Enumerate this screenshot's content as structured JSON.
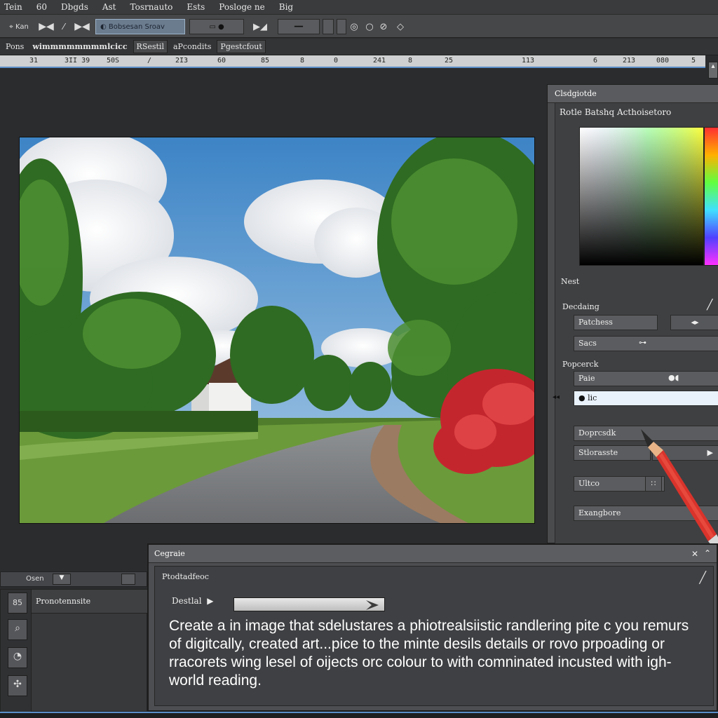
{
  "menu": [
    "Tein",
    "60",
    "Dbgds",
    "Ast",
    "Tosrnauto",
    "Ests",
    "Posloge ne",
    "Big"
  ],
  "toolbar": {
    "mode_label": "Kan",
    "preset_label": "Bobsesan Sroav"
  },
  "options": {
    "label1": "Pons",
    "label2": "wimmmmmmmmlcicc",
    "tab1": "RSestil",
    "label3": "aPcondits",
    "tab2": "Pgestcfout"
  },
  "ruler": [
    "31",
    "3II 39",
    "50S",
    "/",
    "2I3",
    "60",
    "85",
    "8",
    "0",
    "241",
    "8",
    "25",
    "113",
    "6",
    "213",
    "080",
    "5"
  ],
  "panel": {
    "title": "Clsdgiotde",
    "subtitle": "Rotle Batshq Acthoisetoro",
    "section_nest": "Nest",
    "section_decoding": "Decdaing",
    "field1": "Patchess",
    "field2": "Sacs",
    "section_popcerck": "Popcerck",
    "field3": "Paie",
    "field4": "lic",
    "field5": "Doprcsdk",
    "field6": "Stlorasste",
    "field7": "Ultco",
    "field8": "Exangbore"
  },
  "colors": {
    "accent": "#5a8fc9",
    "canvas_bg": "#2b2c2e",
    "panel_bg": "#4a4b4d"
  },
  "dock": {
    "top_label": "Osen",
    "row_label": "Pronotennsite",
    "row_number": "85"
  },
  "dialog": {
    "title": "Cegraie",
    "subtitle": "Ptodtadfeoc",
    "slider_label": "Destlal",
    "body": "Create a in image that sdelustares a phiotrealsiistic randlering pite c you remurs of digitcally, created art...pice to the minte desils details or rovo prpoading or rracorets wing lesel of oijects orc colour to with comninated incusted with igh-world reading."
  }
}
